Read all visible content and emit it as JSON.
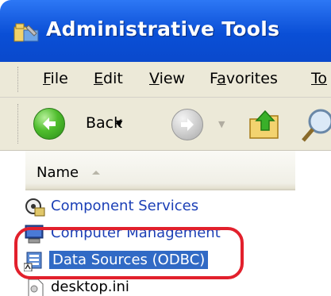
{
  "window": {
    "title": "Administrative Tools"
  },
  "menu": {
    "items": [
      {
        "mnemonic": "F",
        "rest": "ile"
      },
      {
        "mnemonic": "E",
        "rest": "dit"
      },
      {
        "mnemonic": "V",
        "rest": "iew"
      },
      {
        "pre": "F",
        "mnemonic": "a",
        "rest": "vorites"
      },
      {
        "mnemonic": "To",
        "rest": ""
      }
    ]
  },
  "toolbar": {
    "back_label": "Back"
  },
  "list": {
    "column_name": "Name",
    "items": [
      {
        "label": "Component Services",
        "icon": "component-services-icon"
      },
      {
        "label": "Computer Management",
        "icon": "computer-management-icon"
      },
      {
        "label": "Data Sources (ODBC)",
        "icon": "odbc-icon",
        "selected": true
      },
      {
        "label": "desktop.ini",
        "icon": "ini-file-icon"
      }
    ]
  },
  "colors": {
    "title_bar": "#0a4fd6",
    "selection": "#316ac5",
    "highlight_oval": "#e2202c",
    "link_text": "#1b3fb6"
  }
}
